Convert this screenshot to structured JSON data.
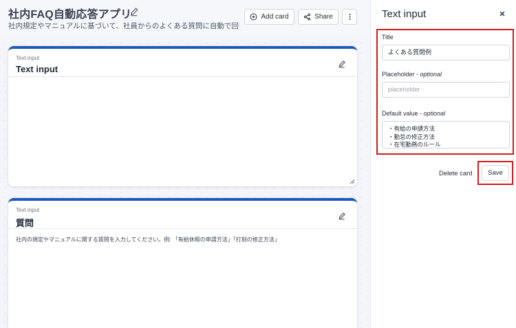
{
  "header": {
    "app_title": "社内FAQ自動応答アプリ",
    "app_description": "社内規定やマニュアルに基づいて、社員からのよくある質問に自動で回答...",
    "add_card_label": "Add card",
    "share_label": "Share"
  },
  "cards": [
    {
      "type_label": "Text input",
      "title": "Text input",
      "body": ""
    },
    {
      "type_label": "Text input",
      "title": "質問",
      "body": "社内の規定やマニュアルに関する質問を入力してください。例: 「有給休暇の申請方法」「打刻の修正方法」"
    }
  ],
  "panel": {
    "title": "Text input",
    "title_label": "Title",
    "title_value": "よくある質問例",
    "placeholder_label": "Placeholder",
    "placeholder_optional": "optional",
    "placeholder_value": "placeholder",
    "default_label": "Default value",
    "default_optional": "optional",
    "default_lines": [
      "・有給の申請方法",
      "・勤怠の修正方法",
      "・在宅勤務のルール"
    ],
    "delete_label": "Delete card",
    "save_label": "Save"
  },
  "colors": {
    "accent_blue": "#1d5ab8",
    "highlight_red": "#d11a1a"
  }
}
